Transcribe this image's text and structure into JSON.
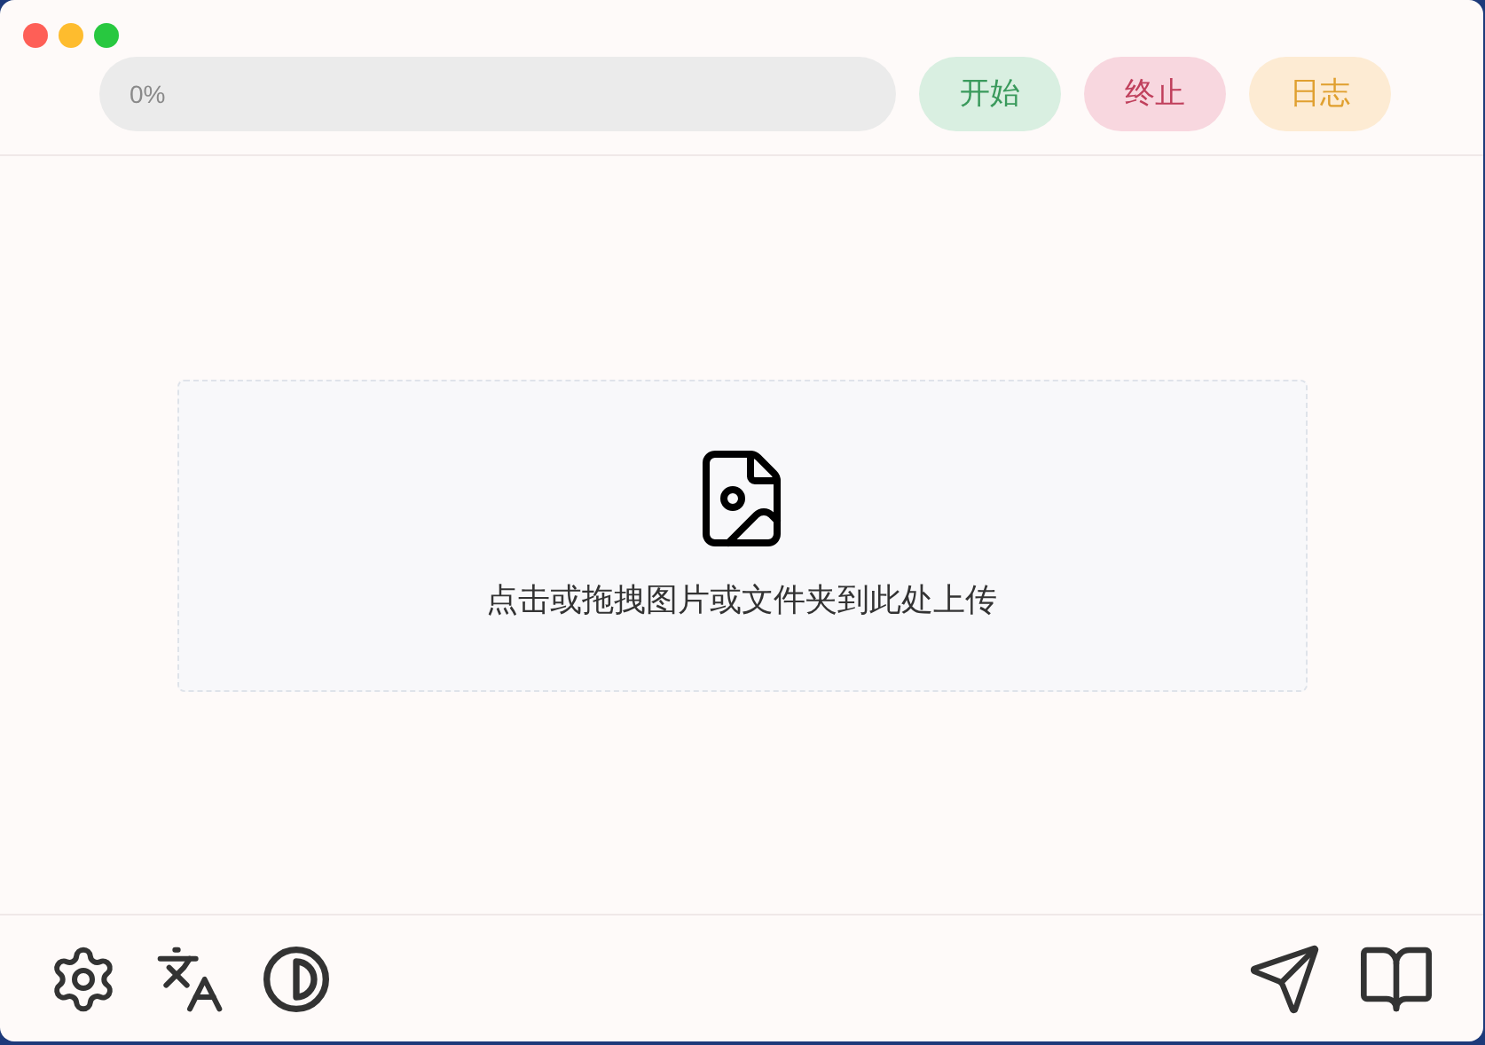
{
  "progress": {
    "level": 0,
    "label": "0%"
  },
  "buttons": [
    {
      "label": "开始",
      "kind": "start"
    },
    {
      "label": "终止",
      "kind": "stop"
    },
    {
      "label": "日志",
      "kind": "log"
    }
  ],
  "dropzone": {
    "text": "点击或拖拽图片或文件夹到此处上传"
  }
}
